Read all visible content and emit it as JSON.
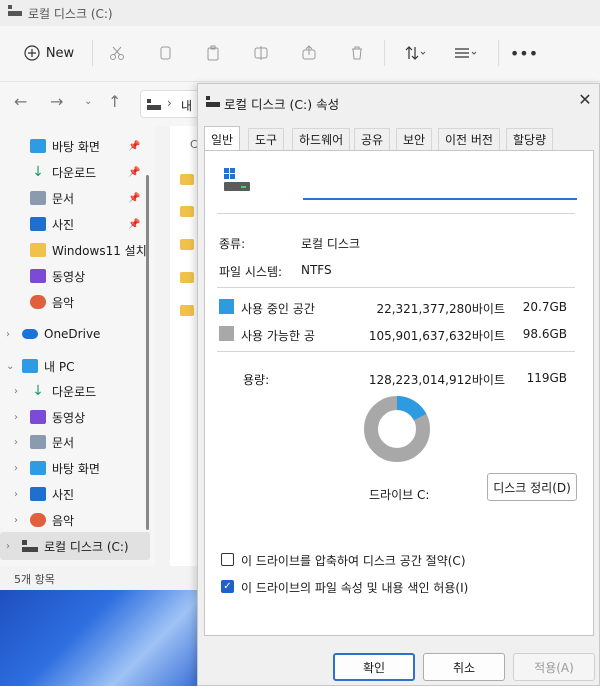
{
  "explorer": {
    "title": "로컬 디스크 (C:)",
    "toolbar": {
      "new_label": "New"
    },
    "address_text": "내",
    "content_header": "C",
    "sidebar": {
      "quick": [
        {
          "label": "바탕 화면",
          "icon": "desktop-icon",
          "pinned": true
        },
        {
          "label": "다운로드",
          "icon": "download-icon",
          "pinned": true
        },
        {
          "label": "문서",
          "icon": "document-icon",
          "pinned": true
        },
        {
          "label": "사진",
          "icon": "pictures-icon",
          "pinned": true
        },
        {
          "label": "Windows11 설치",
          "icon": "folder-icon",
          "pinned": false
        },
        {
          "label": "동영상",
          "icon": "video-icon",
          "pinned": false
        },
        {
          "label": "음악",
          "icon": "music-icon",
          "pinned": false
        }
      ],
      "onedrive": "OneDrive",
      "this_pc": "내 PC",
      "pc_items": [
        {
          "label": "다운로드",
          "icon": "download-icon"
        },
        {
          "label": "동영상",
          "icon": "video-icon"
        },
        {
          "label": "문서",
          "icon": "document-icon"
        },
        {
          "label": "바탕 화면",
          "icon": "desktop-icon"
        },
        {
          "label": "사진",
          "icon": "pictures-icon"
        },
        {
          "label": "음악",
          "icon": "music-icon"
        },
        {
          "label": "로컬 디스크 (C:)",
          "icon": "drive-icon"
        }
      ]
    },
    "status": "5개 항목"
  },
  "dialog": {
    "title": "로컬 디스크 (C:) 속성",
    "tabs": [
      "일반",
      "도구",
      "하드웨어",
      "공유",
      "보안",
      "이전 버전",
      "할당량"
    ],
    "name_value": "",
    "type_label": "종류:",
    "type_value": "로컬 디스크",
    "fs_label": "파일 시스템:",
    "fs_value": "NTFS",
    "used": {
      "label": "사용 중인 공간",
      "bytes": "22,321,377,280바이트",
      "size": "20.7GB"
    },
    "free": {
      "label": "사용 가능한 공",
      "bytes": "105,901,637,632바이트",
      "size": "98.6GB"
    },
    "capacity": {
      "label": "용량:",
      "bytes": "128,223,014,912바이트",
      "size": "119GB"
    },
    "usage_fraction": 0.174,
    "drive_label": "드라이브 C:",
    "cleanup_label": "디스크 정리(D)",
    "compress": {
      "label": "이 드라이브를 압축하여 디스크 공간 절약(C)",
      "checked": false
    },
    "index": {
      "label": "이 드라이브의 파일 속성 및 내용 색인 허용(I)",
      "checked": true
    },
    "ok_label": "확인",
    "cancel_label": "취소",
    "apply_label": "적용(A)"
  },
  "colors": {
    "used": "#2e9be0",
    "free": "#a8a8a8",
    "accent": "#2f6fd1"
  }
}
